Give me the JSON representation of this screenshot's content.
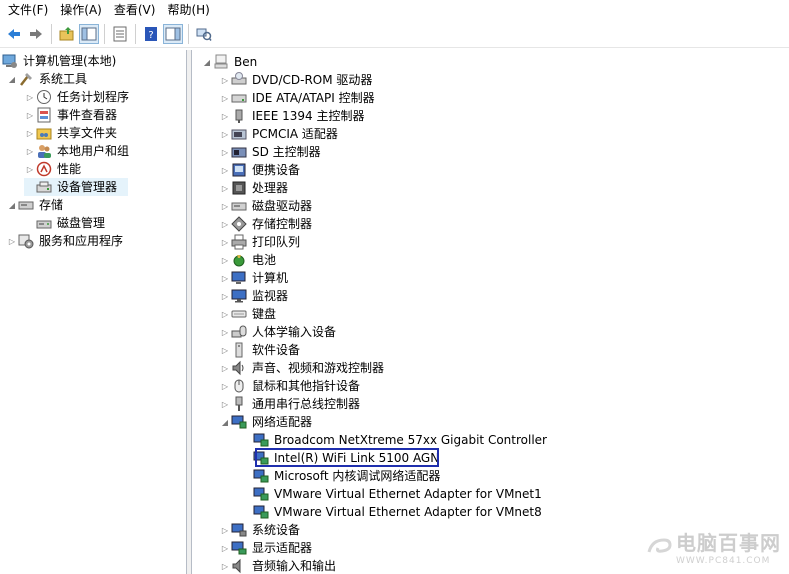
{
  "menu": {
    "file": "文件(F)",
    "action": "操作(A)",
    "view": "查看(V)",
    "help": "帮助(H)"
  },
  "left_tree": {
    "root": "计算机管理(本地)",
    "system_tools": "系统工具",
    "task_scheduler": "任务计划程序",
    "event_viewer": "事件查看器",
    "shared_folders": "共享文件夹",
    "local_users": "本地用户和组",
    "performance": "性能",
    "device_manager": "设备管理器",
    "storage": "存储",
    "disk_management": "磁盘管理",
    "services_apps": "服务和应用程序"
  },
  "device_tree": {
    "computer_name": "Ben",
    "categories": {
      "dvd": "DVD/CD-ROM 驱动器",
      "ide": "IDE ATA/ATAPI 控制器",
      "ieee": "IEEE 1394 主控制器",
      "pcmcia": "PCMCIA 适配器",
      "sd": "SD 主控制器",
      "portable": "便携设备",
      "processor": "处理器",
      "disk": "磁盘驱动器",
      "storage_ctrl": "存储控制器",
      "print_queue": "打印队列",
      "battery": "电池",
      "computer": "计算机",
      "monitor": "监视器",
      "keyboard": "键盘",
      "hid": "人体学输入设备",
      "software": "软件设备",
      "sound": "声音、视频和游戏控制器",
      "mouse": "鼠标和其他指针设备",
      "usb": "通用串行总线控制器",
      "network": "网络适配器",
      "system": "系统设备",
      "display": "显示适配器",
      "audio_io": "音频输入和输出"
    },
    "network_adapters": [
      "Broadcom NetXtreme 57xx Gigabit Controller",
      "Intel(R) WiFi Link 5100 AGN",
      "Microsoft 内核调试网络适配器",
      "VMware Virtual Ethernet Adapter for VMnet1",
      "VMware Virtual Ethernet Adapter for VMnet8"
    ]
  },
  "watermark": {
    "title": "电脑百事网",
    "url": "WWW.PC841.COM"
  },
  "colors": {
    "highlight_border": "#1f2fae",
    "selection": "#e5f3fb"
  }
}
